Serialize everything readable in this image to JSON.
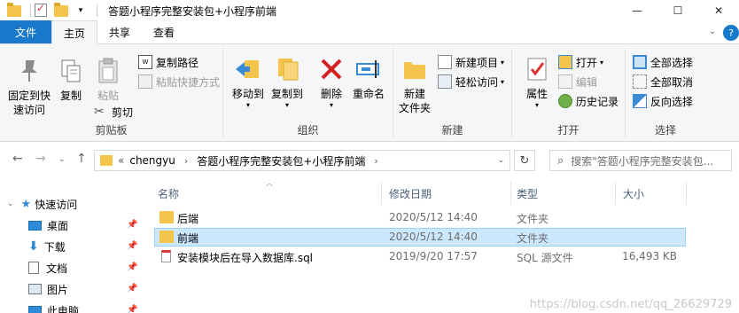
{
  "window": {
    "title": "答题小程序完整安装包+小程序前端",
    "minimize": "—",
    "maximize": "☐",
    "close": "✕"
  },
  "tabs": {
    "file": "文件",
    "home": "主页",
    "share": "共享",
    "view": "查看",
    "help": "?"
  },
  "ribbon": {
    "clipboard": {
      "label": "剪贴板",
      "pin": "固定到快\n速访问",
      "copy": "复制",
      "paste": "粘贴",
      "copy_path": "复制路径",
      "paste_shortcut": "粘贴快捷方式",
      "cut": "剪切"
    },
    "organize": {
      "label": "组织",
      "move_to": "移动到",
      "copy_to": "复制到",
      "delete": "删除",
      "rename": "重命名"
    },
    "new": {
      "label": "新建",
      "new_folder": "新建\n文件夹",
      "new_item": "新建项目",
      "easy_access": "轻松访问"
    },
    "open": {
      "label": "打开",
      "properties": "属性",
      "open": "打开",
      "edit": "编辑",
      "history": "历史记录"
    },
    "select": {
      "label": "选择",
      "select_all": "全部选择",
      "select_none": "全部取消",
      "invert": "反向选择"
    }
  },
  "address": {
    "prefix": "«",
    "crumbs": [
      "chengyu",
      "答题小程序完整安装包+小程序前端"
    ],
    "search_placeholder": "搜索\"答题小程序完整安装包..."
  },
  "nav": {
    "quick_access": "快速访问",
    "items": [
      "桌面",
      "下载",
      "文档",
      "图片",
      "此电脑"
    ]
  },
  "columns": {
    "name": "名称",
    "date": "修改日期",
    "type": "类型",
    "size": "大小"
  },
  "files": [
    {
      "name": "后端",
      "date": "2020/5/12 14:40",
      "type": "文件夹",
      "size": "",
      "icon": "folder-icon"
    },
    {
      "name": "前端",
      "date": "2020/5/12 14:40",
      "type": "文件夹",
      "size": "",
      "icon": "folder-icon"
    },
    {
      "name": "安装模块后在导入数据库.sql",
      "date": "2019/9/20 17:57",
      "type": "SQL 源文件",
      "size": "16,493 KB",
      "icon": "sql-file-icon"
    }
  ],
  "watermark": "https://blog.csdn.net/qq_26629729",
  "colors": {
    "accent": "#1979ca",
    "folder": "#f5c44d",
    "selection": "#cce8ff"
  }
}
